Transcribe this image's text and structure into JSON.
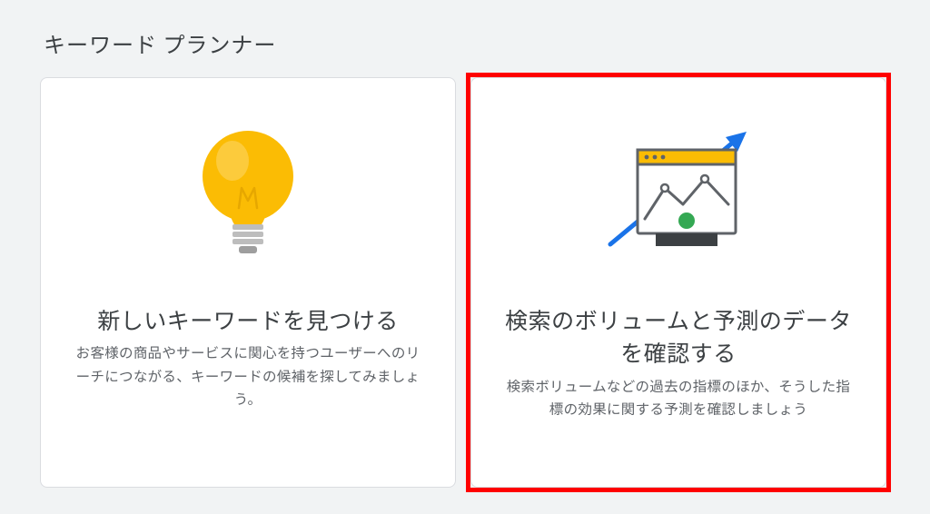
{
  "page_title": "キーワード プランナー",
  "cards": {
    "discover": {
      "title": "新しいキーワードを見つける",
      "description": "お客様の商品やサービスに関心を持つユーザーへのリーチにつながる、キーワードの候補を探してみましょう。"
    },
    "forecast": {
      "title": "検索のボリュームと予測のデータを確認する",
      "description": "検索ボリュームなどの過去の指標のほか、そうした指標の効果に関する予測を確認しましょう"
    }
  }
}
